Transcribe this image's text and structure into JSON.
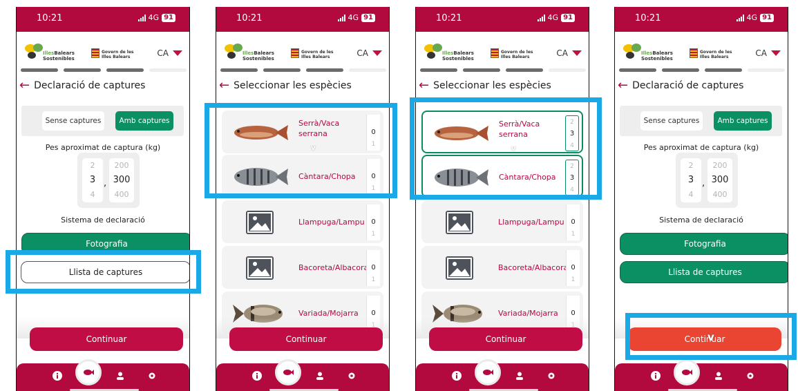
{
  "status": {
    "time": "10:21",
    "network": "4G",
    "battery": "91"
  },
  "header": {
    "logo_line1_a": "Illes",
    "logo_line1_b": "Balears",
    "logo_line2": "Sostenibles",
    "gov_line1": "Govern de les",
    "gov_line2": "Illes Balears",
    "language": "CA"
  },
  "screen1": {
    "title": "Declaració de captures",
    "toggle_off": "Sense captures",
    "toggle_on": "Amb captures",
    "weight_label": "Pes aproximat de captura (kg)",
    "picker_int": [
      "2",
      "3",
      "4"
    ],
    "picker_dec": [
      "200",
      "300",
      "400"
    ],
    "picker_sep": ",",
    "system_label": "Sistema de declaració",
    "photo_btn": "Fotografia",
    "list_btn": "Llista de captures",
    "continue": "Continuar"
  },
  "screen2": {
    "title": "Seleccionar les espècies",
    "species": [
      {
        "name": "Serrà/Vaca serrana",
        "count": "0",
        "next": "1"
      },
      {
        "name": "Càntara/Chopa",
        "count": "0",
        "next": "1"
      },
      {
        "name": "Llampuga/Lampu",
        "count": "0",
        "next": "1"
      },
      {
        "name": "Bacoreta/Albacora",
        "count": "0",
        "next": "1"
      },
      {
        "name": "Variada/Mojarra",
        "count": "0",
        "next": "1"
      }
    ],
    "continue": "Continuar"
  },
  "screen3": {
    "title": "Seleccionar les espècies",
    "species": [
      {
        "name": "Serrà/Vaca serrana",
        "prev": "2",
        "count": "3",
        "next": "4"
      },
      {
        "name": "Càntara/Chopa",
        "prev": "2",
        "count": "3",
        "next": "4"
      },
      {
        "name": "Llampuga/Lampu",
        "count": "0",
        "next": "1"
      },
      {
        "name": "Bacoreta/Albacora",
        "count": "0",
        "next": "1"
      },
      {
        "name": "Variada/Mojarra",
        "count": "0",
        "next": "1"
      }
    ],
    "continue": "Continuar"
  },
  "screen4": {
    "title": "Declaració de captures",
    "toggle_off": "Sense captures",
    "toggle_on": "Amb captures",
    "weight_label": "Pes aproximat de captura (kg)",
    "picker_int": [
      "2",
      "3",
      "4"
    ],
    "picker_dec": [
      "200",
      "300",
      "400"
    ],
    "picker_sep": ",",
    "system_label": "Sistema de declaració",
    "photo_btn": "Fotografia",
    "list_btn": "Llista de captures",
    "continue": "Continuar"
  },
  "icons": {
    "back": "arrow-left-icon",
    "info": "info-icon",
    "fish": "fish-icon",
    "user": "user-icon",
    "settings": "gear-icon",
    "language": "triangle-down-icon",
    "image_placeholder": "image-placeholder-icon"
  },
  "colors": {
    "brand": "#b2093f",
    "green": "#0a9062",
    "highlight": "#1aa9e6",
    "continue_pressed": "#ea4533"
  }
}
